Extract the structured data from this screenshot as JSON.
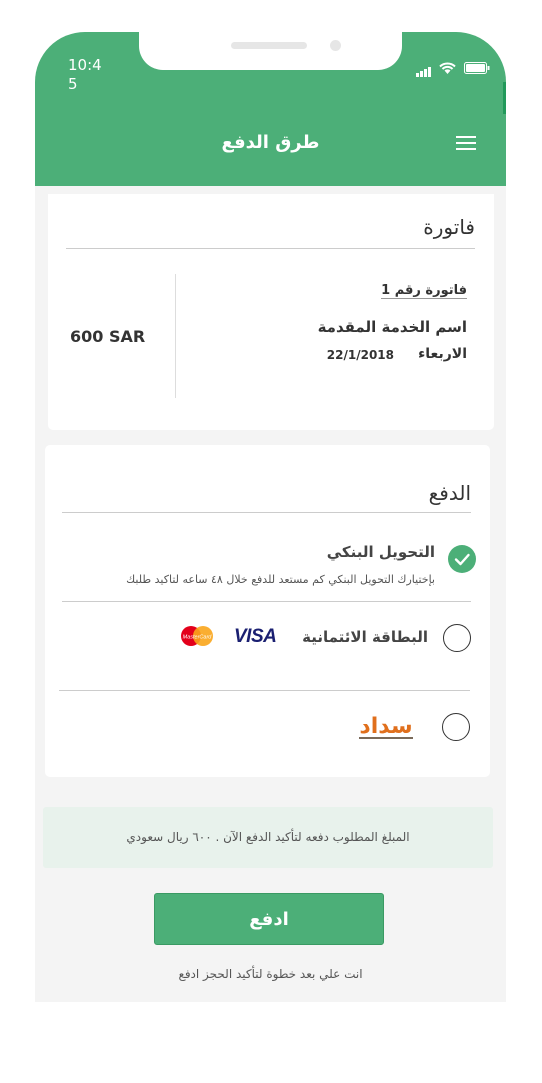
{
  "status_bar": {
    "time": "10:45"
  },
  "header": {
    "title": "طرق الدفع"
  },
  "invoice": {
    "section_title": "فاتورة",
    "number": "فاتورة رقم 1",
    "service_name": "اسم الخدمة المقدمة",
    "day": "الاربعاء",
    "date": "22/1/2018",
    "amount": "600 SAR"
  },
  "payment": {
    "section_title": "الدفع",
    "options": [
      {
        "title": "التحويل البنكي",
        "description": "بإختيارك التحويل البنكي كم مستعد للدفع خلال ٤٨ ساعه لتاكيد طلبك",
        "selected": true
      },
      {
        "title": "البطاقة الائتمانية",
        "logos": [
          "VISA",
          "MasterCard"
        ],
        "selected": false
      },
      {
        "logo": "سداد",
        "selected": false
      }
    ]
  },
  "note": "المبلغ المطلوب دفعه لتأكيد الدفع الآن . ٦٠٠ ريال سعودي",
  "pay_button": "ادفع",
  "footer": "انت علي بعد خطوة لتأكيد الحجز ادفع",
  "colors": {
    "primary": "#4caf78",
    "visa_blue": "#1a1f71",
    "sadad_orange": "#e06f1c"
  }
}
